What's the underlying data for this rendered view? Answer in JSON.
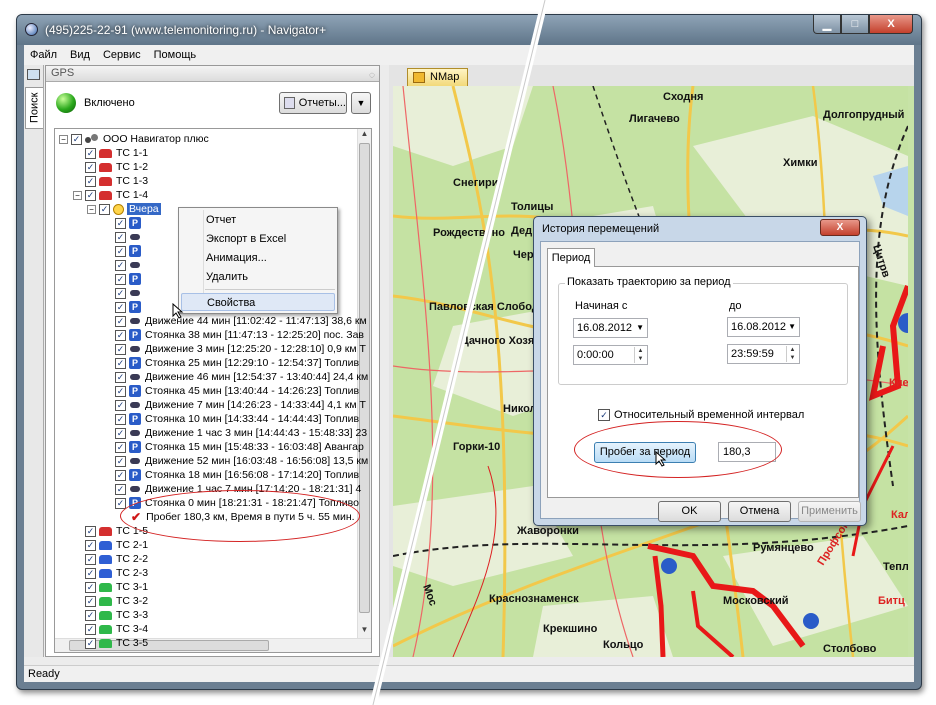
{
  "window": {
    "title": "(495)225-22-91   (www.telemonitoring.ru) - Navigator+",
    "min_label": "▁",
    "max_label": "□",
    "close_label": "X"
  },
  "menu": [
    "Файл",
    "Вид",
    "Сервис",
    "Помощь"
  ],
  "sidetab": {
    "label": "Поиск"
  },
  "gps_panel": {
    "header": "GPS",
    "status": "Включено",
    "reports_button": "Отчеты...",
    "dropdown_arrow": "▼"
  },
  "tree": {
    "org": "ООО Навигатор плюс",
    "vehicles_top": [
      {
        "label": "ТС 1-1",
        "color": "red"
      },
      {
        "label": "ТС 1-2",
        "color": "red"
      },
      {
        "label": "ТС 1-3",
        "color": "red"
      },
      {
        "label": "ТС 1-4",
        "color": "red"
      }
    ],
    "day_node": "Вчера",
    "events_clipped": [
      {
        "icon": "p",
        "text": "3) Топлив"
      },
      {
        "icon": "m",
        "text": "53) 18,2 км"
      },
      {
        "icon": "p",
        "text": "5) пос. Раб"
      },
      {
        "icon": "m",
        "text": "1) 11,4 км"
      },
      {
        "icon": "p",
        "text": "Топливо:"
      },
      {
        "icon": "m",
        "text": "05) 33,1 км"
      },
      {
        "icon": "p",
        "text": "Топлив"
      }
    ],
    "events": [
      {
        "icon": "m",
        "text": "Движение 44 мин [11:02:42 - 11:47:13] 38,6 км"
      },
      {
        "icon": "p",
        "text": "Стоянка 38 мин [11:47:13 - 12:25:20] пос. Зав"
      },
      {
        "icon": "m",
        "text": "Движение 3 мин [12:25:20 - 12:28:10] 0,9 км  Т"
      },
      {
        "icon": "p",
        "text": "Стоянка 25 мин [12:29:10 - 12:54:37] Топлив"
      },
      {
        "icon": "m",
        "text": "Движение 46 мин [12:54:37 - 13:40:44] 24,4 км"
      },
      {
        "icon": "p",
        "text": "Стоянка 45 мин [13:40:44 - 14:26:23] Топлив"
      },
      {
        "icon": "m",
        "text": "Движение 7 мин [14:26:23 - 14:33:44] 4,1 км  Т"
      },
      {
        "icon": "p",
        "text": "Стоянка 10 мин [14:33:44 - 14:44:43] Топлив"
      },
      {
        "icon": "m",
        "text": "Движение 1 час 3 мин [14:44:43 - 15:48:33] 23"
      },
      {
        "icon": "p",
        "text": "Стоянка 15 мин [15:48:33 - 16:03:48] Авангар"
      },
      {
        "icon": "m",
        "text": "Движение 52 мин [16:03:48 - 16:56:08] 13,5 км"
      },
      {
        "icon": "p",
        "text": "Стоянка 18 мин [16:56:08 - 17:14:20] Топлив"
      },
      {
        "icon": "m",
        "text": "Движение 1 час 7 мин [17:14:20 - 18:21:31] 4"
      },
      {
        "icon": "p",
        "text": "Стоянка 0 мин [18:21:31 - 18:21:47] Топливо"
      }
    ],
    "summary": "Пробег 180,3 км, Время в пути 5 ч. 55 мин.",
    "vehicles_bottom": [
      {
        "label": "ТС 1-5",
        "color": "red"
      },
      {
        "label": "ТС 2-1",
        "color": "blue"
      },
      {
        "label": "ТС 2-2",
        "color": "blue"
      },
      {
        "label": "ТС 2-3",
        "color": "blue"
      },
      {
        "label": "ТС 3-1",
        "color": "green"
      },
      {
        "label": "ТС 3-2",
        "color": "green"
      },
      {
        "label": "ТС 3-3",
        "color": "green"
      },
      {
        "label": "ТС 3-4",
        "color": "green"
      },
      {
        "label": "ТС 3-5",
        "color": "green"
      }
    ]
  },
  "context_menu": {
    "items": [
      "Отчет",
      "Экспорт в Excel",
      "Анимация...",
      "Удалить"
    ],
    "properties": "Свойства"
  },
  "map": {
    "tab": "NMap",
    "places": [
      "Сходня",
      "Лигачево",
      "Долгопрудный",
      "Химки",
      "Снегири",
      "Толицы",
      "Рождествено",
      "Павловская Слобода",
      "Дачного Хозяйства",
      "Николина",
      "Горки-10",
      "Жаворонки",
      "Краснознаменск",
      "Московский",
      "Румянцево",
      "Крекшино",
      "Кольцо",
      "Столбово",
      "Теплый ста",
      "Битц",
      "Калуж",
      "Кие",
      "Чер",
      "Дед",
      "Мос",
      "Профсоюзная",
      "Цитрв"
    ]
  },
  "dialog": {
    "title": "История перемещений",
    "close": "X",
    "tab": "Период",
    "group": "Показать траекторию за период",
    "from_label": "Начиная с",
    "to_label": "до",
    "from_date": "16.08.2012",
    "to_date": "16.08.2012",
    "from_time": "0:00:00",
    "to_time": "23:59:59",
    "relative_checkbox": "Относительный временной интервал",
    "mileage_button": "Пробег за период",
    "mileage_value": "180,3",
    "ok": "OK",
    "cancel": "Отмена",
    "apply": "Применить"
  },
  "statusbar": {
    "text": "Ready"
  },
  "colors": {
    "highlight": "#d42424",
    "selection": "#3468c6",
    "route": "#e81818"
  }
}
